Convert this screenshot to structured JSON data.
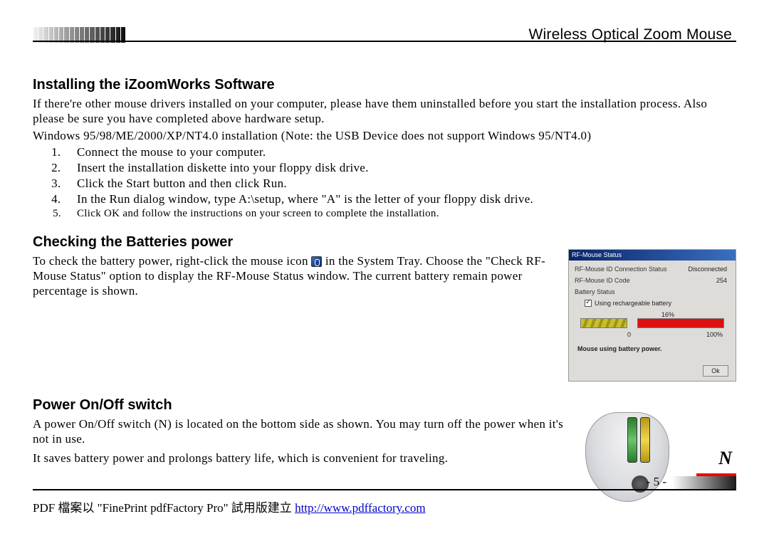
{
  "header": {
    "product": "Wireless Optical Zoom Mouse"
  },
  "section1": {
    "heading": "Installing the iZoomWorks Software",
    "intro1": "If there're other mouse drivers installed on your computer, please have them uninstalled before you start the installation process. Also please be sure you have completed above hardware setup.",
    "intro2": "Windows 95/98/ME/2000/XP/NT4.0 installation (Note: the USB Device does not support Windows 95/NT4.0)",
    "steps": [
      "Connect the mouse to your computer.",
      "Insert the installation diskette into your floppy disk drive.",
      "Click the Start button and then click Run.",
      "In the Run dialog window, type A:\\setup, where \"A\" is the letter of your floppy disk drive.",
      "Click OK and follow the instructions on your screen to complete the installation."
    ]
  },
  "section2": {
    "heading": "Checking the Batteries power",
    "p1a": "To check the battery power, right-click the mouse icon",
    "p1b": "in the System Tray. Choose the \"Check RF-Mouse Status\" option to display the RF-Mouse Status window. The current battery remain power percentage is shown.",
    "dialog": {
      "title": "RF-Mouse Status",
      "row1_label": "RF-Mouse ID Connection Status",
      "row1_val": "Disconnected",
      "row2_label": "RF-Mouse ID Code",
      "row2_val": "254",
      "row3_label": "Battery Status",
      "checkbox": "Using rechargeable battery",
      "percent": "16%",
      "scale0": "0",
      "scale100": "100%",
      "message": "Mouse using battery power.",
      "ok": "Ok"
    }
  },
  "section3": {
    "heading": "Power On/Off switch",
    "p1": "A power On/Off switch (N) is located on the bottom side as shown. You may turn off the power when it's not in use.",
    "p2": "It saves battery power and prolongs battery life, which is convenient for traveling.",
    "callout": "N"
  },
  "page_number": "- 5 -",
  "footer": {
    "text_prefix": "PDF 檔案以 \"FinePrint pdfFactory Pro\" 試用版建立    ",
    "link_text": "http://www.pdffactory.com"
  }
}
